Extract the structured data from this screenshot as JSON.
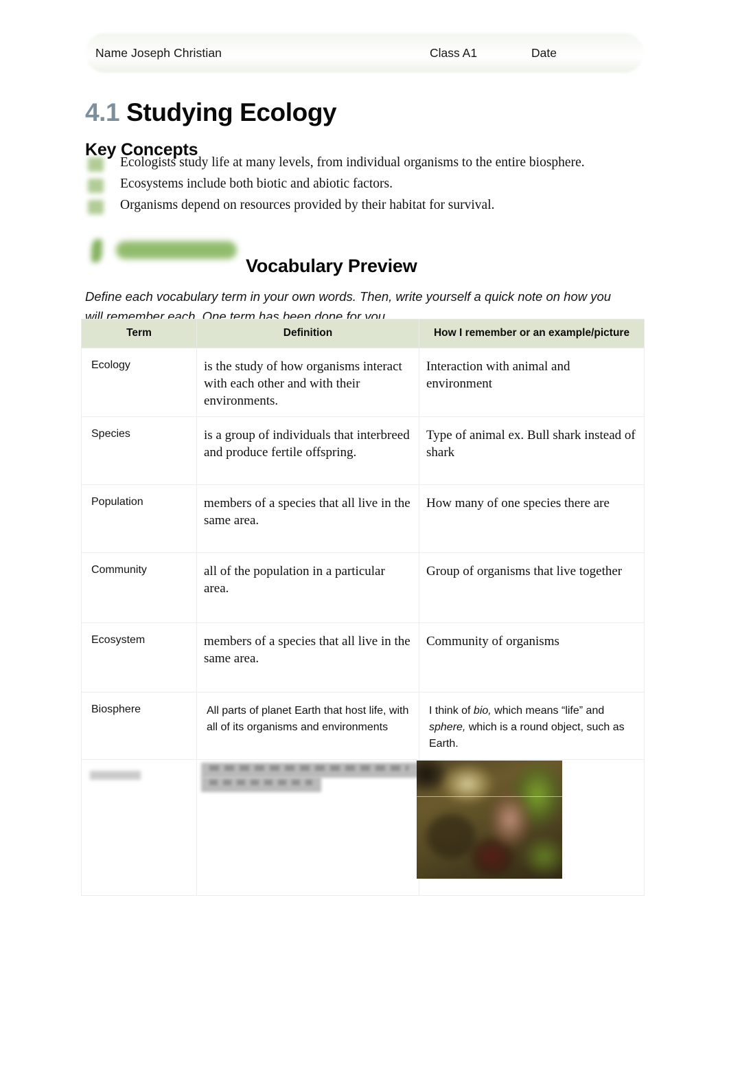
{
  "header": {
    "name_label": "Name",
    "name_value": "Joseph Christian",
    "name_line": "Name Joseph Christian",
    "class_label": "Class",
    "class_value": "A1",
    "class_line": "Class A1",
    "date_label": "Date",
    "date_value": ""
  },
  "title": {
    "number": "4.1",
    "text": "Studying Ecology"
  },
  "key_concepts": {
    "heading": "Key Concepts",
    "items": [
      "Ecologists study life at many levels, from individual organisms to the entire biosphere.",
      "Ecosystems include both biotic and abiotic factors.",
      "Organisms depend on resources provided by their habitat for survival."
    ]
  },
  "vocabulary_preview": {
    "title": "Vocabulary Preview",
    "instructions": "Define each vocabulary term in your own words. Then, write yourself a quick note on how you will remember each. One term has been done for you."
  },
  "table": {
    "columns": [
      "Term",
      "Definition",
      "How I remember or an example/picture"
    ],
    "rows": [
      {
        "term": "Ecology",
        "definition": "is the study of how organisms interact with each other and with their environments.",
        "how_i_remember": "Interaction with animal and environment",
        "style": "student"
      },
      {
        "term": "Species",
        "definition": "is a group of individuals that interbreed and produce fertile offspring.",
        "how_i_remember": "Type of animal ex. Bull shark instead of shark",
        "style": "student"
      },
      {
        "term": "Population",
        "definition": "members of a species that all live in the same area.",
        "how_i_remember": "How many of one species there are",
        "style": "student"
      },
      {
        "term": "Community",
        "definition": "all of the population in a particular area.",
        "how_i_remember": "Group of organisms that live together",
        "style": "student"
      },
      {
        "term": "Ecosystem",
        "definition": "members of a species that all live in the same area.",
        "how_i_remember": "Community of organisms",
        "style": "student"
      },
      {
        "term": "Biosphere",
        "definition": "All parts of planet Earth that host life, with all of its organisms and environments",
        "how_i_remember_prefix": "I think of ",
        "how_i_remember_italic1": "bio,",
        "how_i_remember_mid": " which means “life” and ",
        "how_i_remember_italic2": "sphere,",
        "how_i_remember_suffix": " which is a round object, such as Earth.",
        "style": "printed-example"
      },
      {
        "term": "",
        "definition": "",
        "how_i_remember": "",
        "style": "redacted"
      }
    ]
  },
  "colors": {
    "title_number": "#7e8f9b",
    "table_header_bg": "#dde4cf",
    "bullet_green": "#a9c78b",
    "deco_green": "#86b55e",
    "banner_tint": "#eef2ea",
    "text": "#121212",
    "border": "#eceded"
  }
}
